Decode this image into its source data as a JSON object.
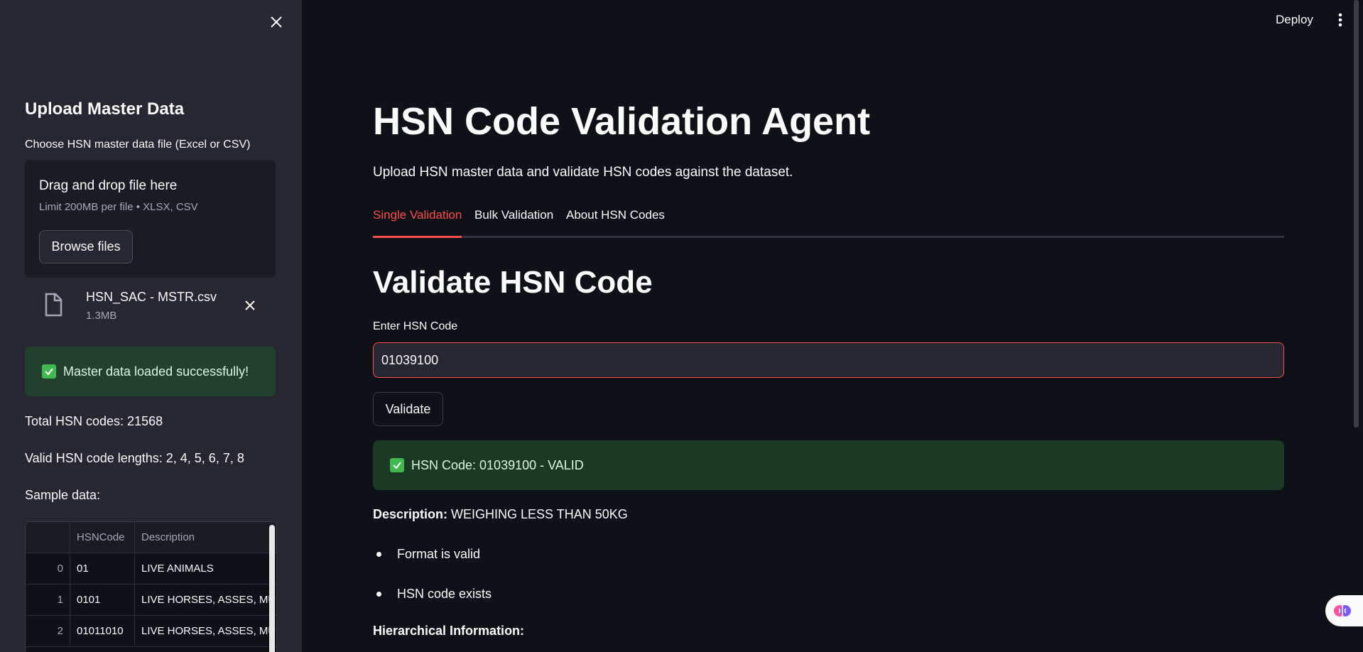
{
  "sidebar": {
    "title": "Upload Master Data",
    "uploader_label": "Choose HSN master data file (Excel or CSV)",
    "dropzone_title": "Drag and drop file here",
    "dropzone_limit": "Limit 200MB per file • XLSX, CSV",
    "browse_label": "Browse files",
    "file": {
      "name": "HSN_SAC - MSTR.csv",
      "size": "1.3MB"
    },
    "success_message": "Master data loaded successfully!",
    "total_codes": "Total HSN codes: 21568",
    "valid_lengths": "Valid HSN code lengths: 2, 4, 5, 6, 7, 8",
    "sample_label": "Sample data:",
    "table": {
      "headers": [
        "",
        "HSNCode",
        "Description"
      ],
      "rows": [
        [
          "0",
          "01",
          "LIVE ANIMALS"
        ],
        [
          "1",
          "0101",
          "LIVE HORSES, ASSES, MULES"
        ],
        [
          "2",
          "01011010",
          "LIVE HORSES, ASSES, MULES"
        ]
      ]
    }
  },
  "header": {
    "deploy_label": "Deploy"
  },
  "main": {
    "title": "HSN Code Validation Agent",
    "subtitle": "Upload HSN master data and validate HSN codes against the dataset.",
    "tabs": [
      {
        "label": "Single Validation",
        "active": true
      },
      {
        "label": "Bulk Validation",
        "active": false
      },
      {
        "label": "About HSN Codes",
        "active": false
      }
    ],
    "section_title": "Validate HSN Code",
    "input_label": "Enter HSN Code",
    "input_value": "01039100",
    "validate_label": "Validate",
    "result_message": "HSN Code: 01039100 - VALID",
    "description_label": "Description:",
    "description_value": "WEIGHING LESS THAN 50KG",
    "checks": [
      "Format is valid",
      "HSN code exists"
    ],
    "hierarchy_label": "Hierarchical Information:"
  },
  "colors": {
    "accent": "#ff4b4b",
    "success_bg": "#1b3a26",
    "background": "#0e1117",
    "sidebar": "#262730"
  }
}
